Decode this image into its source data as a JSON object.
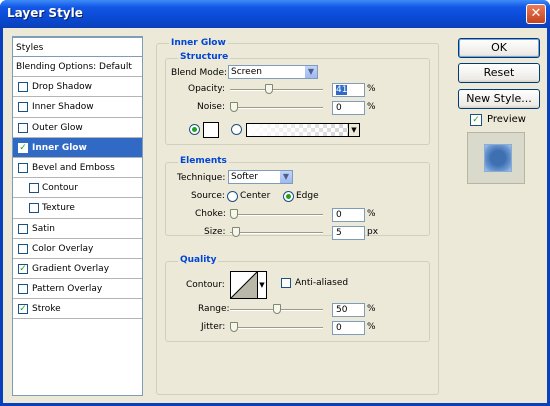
{
  "window": {
    "title": "Layer Style",
    "close_glyph": "✕"
  },
  "styles_panel": {
    "header": "Styles",
    "items": [
      {
        "label": "Blending Options: Default",
        "kind": "blend",
        "checked": false
      },
      {
        "label": "Drop Shadow",
        "kind": "item",
        "checked": false
      },
      {
        "label": "Inner Shadow",
        "kind": "item",
        "checked": false
      },
      {
        "label": "Outer Glow",
        "kind": "item",
        "checked": false
      },
      {
        "label": "Inner Glow",
        "kind": "item",
        "checked": true,
        "selected": true
      },
      {
        "label": "Bevel and Emboss",
        "kind": "item",
        "checked": false
      },
      {
        "label": "Contour",
        "kind": "sub",
        "checked": false
      },
      {
        "label": "Texture",
        "kind": "sub",
        "checked": false
      },
      {
        "label": "Satin",
        "kind": "item",
        "checked": false
      },
      {
        "label": "Color Overlay",
        "kind": "item",
        "checked": false
      },
      {
        "label": "Gradient Overlay",
        "kind": "item",
        "checked": true
      },
      {
        "label": "Pattern Overlay",
        "kind": "item",
        "checked": false
      },
      {
        "label": "Stroke",
        "kind": "item",
        "checked": true
      }
    ]
  },
  "inner_glow": {
    "title": "Inner Glow",
    "structure": {
      "title": "Structure",
      "blend_mode_label": "Blend Mode:",
      "blend_mode_value": "Screen",
      "opacity_label": "Opacity:",
      "opacity_value": "41",
      "opacity_unit": "%",
      "opacity_level": 41,
      "noise_label": "Noise:",
      "noise_value": "0",
      "noise_unit": "%",
      "noise_level": 0,
      "color_mode": "solid"
    },
    "elements": {
      "title": "Elements",
      "technique_label": "Technique:",
      "technique_value": "Softer",
      "source_label": "Source:",
      "source_center": "Center",
      "source_edge": "Edge",
      "source_selected": "edge",
      "choke_label": "Choke:",
      "choke_value": "0",
      "choke_unit": "%",
      "choke_level": 0,
      "size_label": "Size:",
      "size_value": "5",
      "size_unit": "px",
      "size_level": 2
    },
    "quality": {
      "title": "Quality",
      "contour_label": "Contour:",
      "anti_aliased_label": "Anti-aliased",
      "anti_aliased_checked": false,
      "range_label": "Range:",
      "range_value": "50",
      "range_unit": "%",
      "range_level": 50,
      "jitter_label": "Jitter:",
      "jitter_value": "0",
      "jitter_unit": "%",
      "jitter_level": 0
    }
  },
  "buttons": {
    "ok": "OK",
    "reset": "Reset",
    "new_style": "New Style...",
    "preview_label": "Preview",
    "preview_checked": true
  },
  "colors": {
    "accent": "#0046d5",
    "selection": "#316ac5",
    "dialog_bg": "#ece9d8",
    "titlebar": "#0a4bd6",
    "check": "#21a121"
  }
}
